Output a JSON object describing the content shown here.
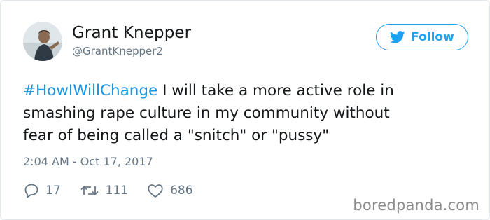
{
  "tweet": {
    "author": {
      "name": "Grant Knepper",
      "handle": "@GrantKnepper2"
    },
    "follow_label": "Follow",
    "hashtag": "#HowIWillChange",
    "text_line1_rest": " I will take a more active role in",
    "text_line2": "smashing rape culture in my community without",
    "text_line3": "fear of being called a \"snitch\" or \"pussy\"",
    "timestamp": "2:04 AM - Oct 17, 2017",
    "stats": {
      "replies": "17",
      "retweets": "111",
      "likes": "686"
    }
  },
  "watermark": "boredpanda.com",
  "colors": {
    "accent": "#1da1f2",
    "hashtag": "#1b95e0",
    "muted": "#657786",
    "text": "#14171a"
  },
  "icons": {
    "follow": "twitter-bird-icon",
    "replies": "reply-icon",
    "retweets": "retweet-icon",
    "likes": "heart-icon"
  }
}
